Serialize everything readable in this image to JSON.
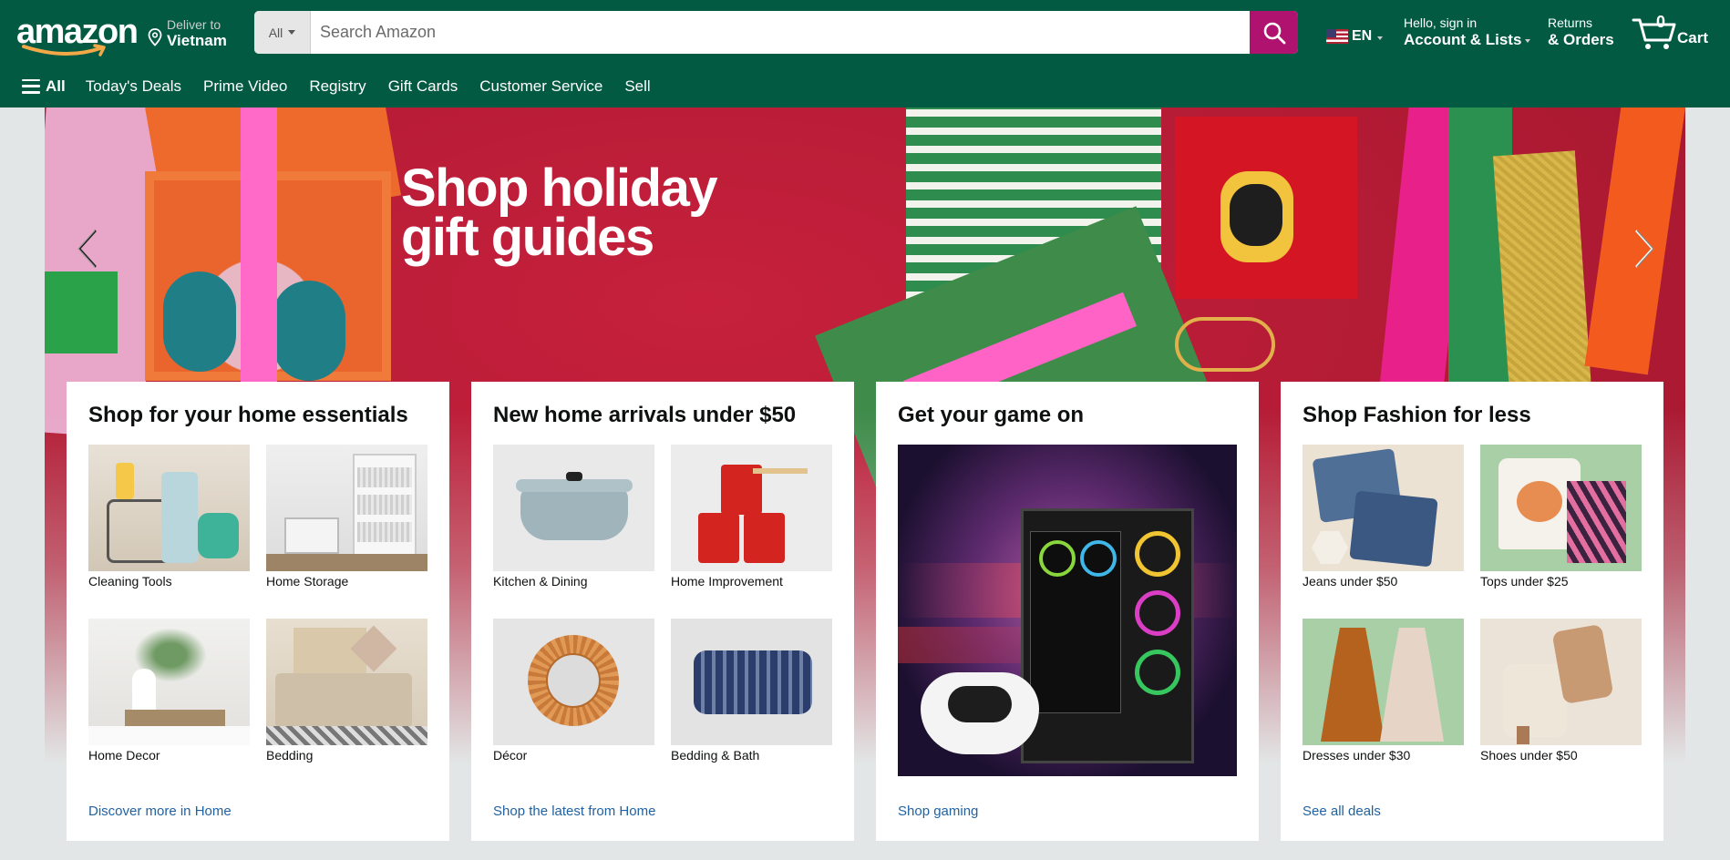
{
  "header": {
    "logo_text": "amazon",
    "deliver_line1": "Deliver to",
    "deliver_line2": "Vietnam",
    "search_category": "All",
    "search_placeholder": "Search Amazon",
    "language": "EN",
    "account_line1": "Hello, sign in",
    "account_line2": "Account & Lists",
    "returns_line1": "Returns",
    "returns_line2": "& Orders",
    "cart_count": "0",
    "cart_label": "Cart"
  },
  "subnav": {
    "all_label": "All",
    "items": [
      "Today's Deals",
      "Prime Video",
      "Registry",
      "Gift Cards",
      "Customer Service",
      "Sell"
    ]
  },
  "hero": {
    "title": "Shop holiday\ngift guides"
  },
  "cards": [
    {
      "title": "Shop for your home essentials",
      "tiles": [
        "Cleaning Tools",
        "Home Storage",
        "Home Decor",
        "Bedding"
      ],
      "link": "Discover more in Home"
    },
    {
      "title": "New home arrivals under $50",
      "tiles": [
        "Kitchen & Dining",
        "Home Improvement",
        "Décor",
        "Bedding & Bath"
      ],
      "link": "Shop the latest from Home"
    },
    {
      "title": "Get your game on",
      "link": "Shop gaming"
    },
    {
      "title": "Shop Fashion for less",
      "tiles": [
        "Jeans under $50",
        "Tops under $25",
        "Dresses under $30",
        "Shoes under $50"
      ],
      "link": "See all deals"
    }
  ],
  "colors": {
    "header_bg": "#035a43",
    "search_button": "#b0126f",
    "hero_red": "#c41f3a",
    "link_blue": "#2162a1"
  }
}
